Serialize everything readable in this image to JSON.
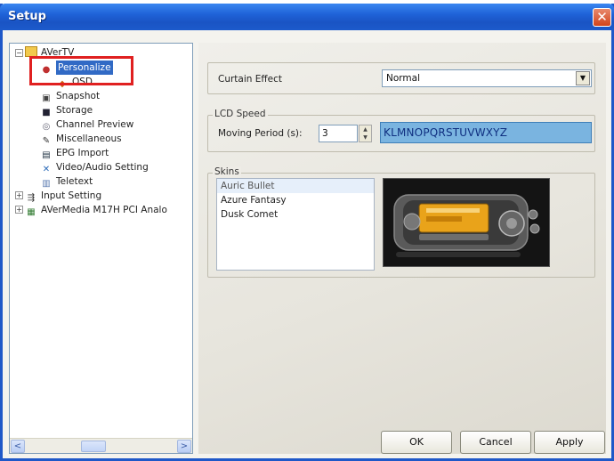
{
  "window": {
    "title": "Setup",
    "close_glyph": "✕"
  },
  "tree": {
    "items": [
      {
        "label": "AVerTV",
        "icon": "app-folder-icon"
      },
      {
        "label": "Personalize",
        "icon": "people-icon",
        "selected": true
      },
      {
        "label": "OSD",
        "icon": "osd-icon"
      },
      {
        "label": "Snapshot",
        "icon": "camera-icon"
      },
      {
        "label": "Storage",
        "icon": "disk-icon"
      },
      {
        "label": "Channel Preview",
        "icon": "eye-icon"
      },
      {
        "label": "Miscellaneous",
        "icon": "wrench-icon"
      },
      {
        "label": "EPG Import",
        "icon": "epg-icon"
      },
      {
        "label": "Video/Audio Setting",
        "icon": "tools-icon"
      },
      {
        "label": "Teletext",
        "icon": "teletext-icon"
      },
      {
        "label": "Input Setting",
        "icon": "input-icon"
      },
      {
        "label": "AVerMedia M17H PCI Analo",
        "icon": "card-icon"
      }
    ],
    "scroll_left": "<",
    "scroll_right": ">"
  },
  "curtain": {
    "label": "Curtain Effect",
    "value": "Normal"
  },
  "lcd": {
    "group_label": "LCD Speed",
    "period_label": "Moving Period (s):",
    "period_value": "3",
    "display_text": "KLMNOPQRSTUVWXYZ"
  },
  "skins": {
    "group_label": "Skins",
    "items": [
      "Auric Bullet",
      "Azure Fantasy",
      "Dusk Comet"
    ]
  },
  "buttons": {
    "ok": "OK",
    "cancel": "Cancel",
    "apply": "Apply"
  },
  "colors": {
    "title_bar": "#1f62d8",
    "lcd_bg": "#7ab4e0",
    "highlight": "#e02020",
    "selection": "#316ac5"
  }
}
